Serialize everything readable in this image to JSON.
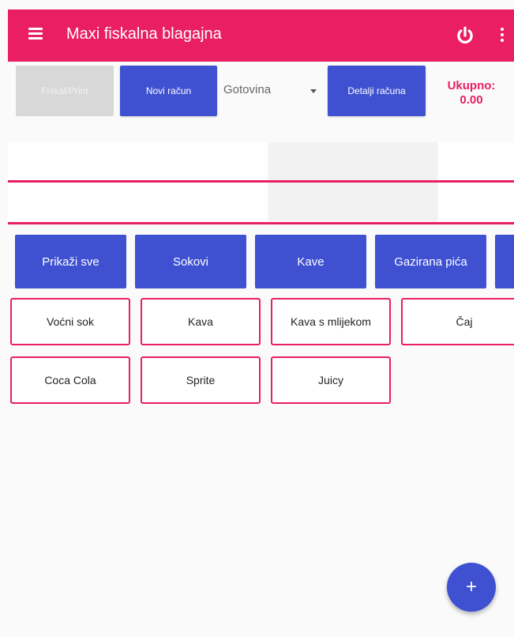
{
  "appbar": {
    "title": "Maxi fiskalna blagajna",
    "color": "#e91e63",
    "icons": [
      "menu-icon",
      "power-icon",
      "more-vert-icon"
    ]
  },
  "toolbar": {
    "fiskal_label": "Fiskal/Print",
    "novi_label": "Novi račun",
    "payment_selected": "Gotovina",
    "detalji_label": "Detalji računa",
    "total_label": "Ukupno:",
    "total_value": "0.00"
  },
  "categories": [
    "Prikaži sve",
    "Sokovi",
    "Kave",
    "Gazirana pića"
  ],
  "products": [
    "Voćni sok",
    "Kava",
    "Kava s mlijekom",
    "Čaj",
    "Coca Cola",
    "Sprite",
    "Juicy"
  ],
  "fab": {
    "label": "+"
  },
  "colors": {
    "primary": "#e91e63",
    "accent": "#3f51d1",
    "disabled": "#d8d8d8"
  }
}
